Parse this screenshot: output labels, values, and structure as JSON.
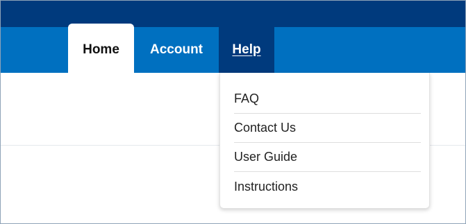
{
  "nav": {
    "tabs": [
      {
        "label": "Home",
        "state": "selected"
      },
      {
        "label": "Account",
        "state": "default"
      },
      {
        "label": "Help",
        "state": "open"
      }
    ]
  },
  "help_menu": {
    "items": [
      {
        "label": "FAQ"
      },
      {
        "label": "Contact Us"
      },
      {
        "label": "User Guide"
      },
      {
        "label": "Instructions"
      }
    ]
  },
  "colors": {
    "top_bar": "#003a7d",
    "nav_bar": "#0070c0",
    "active_tab": "#003a7d",
    "selected_tab": "#ffffff"
  }
}
